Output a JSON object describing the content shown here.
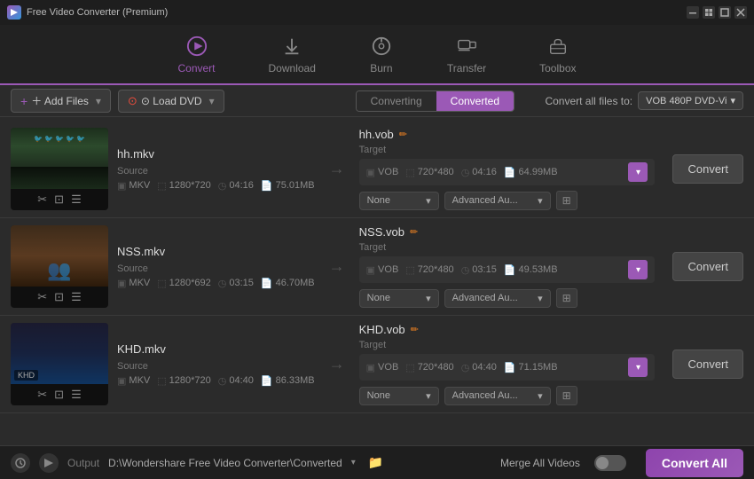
{
  "app": {
    "title": "Free Video Converter (Premium)",
    "icon": "▶"
  },
  "titlebar": {
    "buttons": [
      "—",
      "□",
      "✕"
    ]
  },
  "nav": {
    "items": [
      {
        "id": "convert",
        "label": "Convert",
        "active": true
      },
      {
        "id": "download",
        "label": "Download",
        "active": false
      },
      {
        "id": "burn",
        "label": "Burn",
        "active": false
      },
      {
        "id": "transfer",
        "label": "Transfer",
        "active": false
      },
      {
        "id": "toolbox",
        "label": "Toolbox",
        "active": false
      }
    ]
  },
  "toolbar": {
    "add_files": "＋ Add Files",
    "load_dvd": "⊙ Load DVD",
    "tab_converting": "Converting",
    "tab_converted": "Converted",
    "convert_all_to": "Convert all files to:",
    "format": "VOB 480P DVD-Vi",
    "format_dropdown": "▾"
  },
  "files": [
    {
      "id": 1,
      "source_name": "hh.mkv",
      "source_format": "MKV",
      "source_res": "1280*720",
      "source_duration": "04:16",
      "source_size": "75.01MB",
      "target_name": "hh.vob",
      "target_format": "VOB",
      "target_res": "720*480",
      "target_duration": "04:16",
      "target_size": "64.99MB",
      "subtitle": "None",
      "advanced": "Advanced Au...",
      "thumb_class": "thumb-birds",
      "thumb_text": "🐦"
    },
    {
      "id": 2,
      "source_name": "NSS.mkv",
      "source_format": "MKV",
      "source_res": "1280*692",
      "source_duration": "03:15",
      "source_size": "46.70MB",
      "target_name": "NSS.vob",
      "target_format": "VOB",
      "target_res": "720*480",
      "target_duration": "03:15",
      "target_size": "49.53MB",
      "subtitle": "None",
      "advanced": "Advanced Au...",
      "thumb_class": "thumb-people",
      "thumb_text": "👥"
    },
    {
      "id": 3,
      "source_name": "KHD.mkv",
      "source_format": "MKV",
      "source_res": "1280*720",
      "source_duration": "04:40",
      "source_size": "86.33MB",
      "target_name": "KHD.vob",
      "target_format": "VOB",
      "target_res": "720*480",
      "target_duration": "04:40",
      "target_size": "71.15MB",
      "subtitle": "None",
      "advanced": "Advanced Au...",
      "thumb_class": "thumb-dark",
      "thumb_text": "🎬"
    }
  ],
  "bottom": {
    "output_label": "Output",
    "output_path": "D:\\Wondershare Free Video Converter\\Converted",
    "merge_label": "Merge All Videos",
    "convert_all": "Convert All"
  },
  "labels": {
    "source": "Source",
    "target": "Target",
    "none": "None",
    "convert": "Convert",
    "advanced": "Advanced Au...",
    "chevron_down": "▾",
    "arrow_right": "→",
    "edit_icon": "✏",
    "scissors": "✂",
    "crop": "⊡",
    "effects": "≡",
    "adjust": "⊞"
  }
}
